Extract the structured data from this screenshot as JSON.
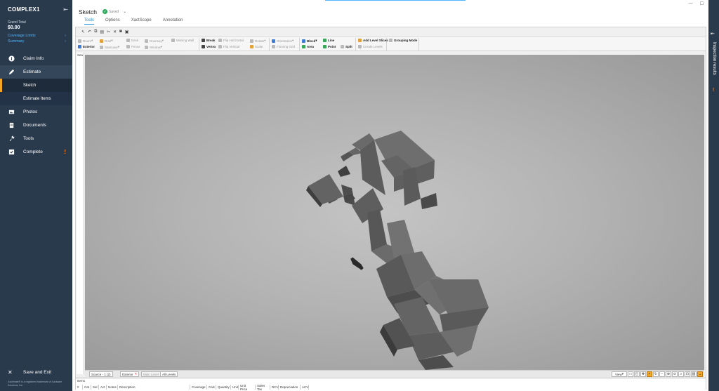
{
  "sidebar": {
    "title": "COMPLEX1",
    "grand_total_label": "Grand Total",
    "grand_total_value": "$0.00",
    "coverage_limits": "Coverage Limits",
    "summary": "Summary",
    "items": [
      {
        "label": "Claim Info",
        "icon": "info-icon"
      },
      {
        "label": "Estimate",
        "icon": "pencil-icon"
      },
      {
        "label": "Photos",
        "icon": "photos-icon"
      },
      {
        "label": "Documents",
        "icon": "documents-icon"
      },
      {
        "label": "Tools",
        "icon": "wrench-icon"
      },
      {
        "label": "Complete",
        "icon": "checklist-icon"
      }
    ],
    "sub_items": [
      {
        "label": "Sketch"
      },
      {
        "label": "Estimate Items"
      }
    ],
    "save_exit": "Save and Exit",
    "legal": "Xactimate® is a registered trademark of Xactware Solutions, Inc.",
    "accent_color": "#f5a623",
    "warn_color": "#f47b20"
  },
  "header": {
    "title": "Sketch",
    "saved": "Saved",
    "tabs": [
      "Tools",
      "Options",
      "XactScope",
      "Annotation"
    ]
  },
  "ribbon": {
    "col1": [
      "Room",
      "Exterior"
    ],
    "col2": [
      "Roof",
      "Staircase"
    ],
    "col3": [
      "Deck",
      "Fence"
    ],
    "col4": [
      "Doorway",
      "Window"
    ],
    "col5": [
      "Missing Wall"
    ],
    "col6": [
      "Break",
      "Vertex"
    ],
    "col7": [
      "Flip Horizontal",
      "Flip Vertical"
    ],
    "col8": [
      "Rotate",
      "Scale"
    ],
    "col9": [
      "Orientation",
      "Flooring Grid"
    ],
    "col10": [
      "Block",
      "Area"
    ],
    "col11": [
      "Line",
      "Point",
      "Split"
    ],
    "col12": [
      "Add Level Slices",
      "Create Levels"
    ],
    "col13": [
      "Grouping Mode"
    ]
  },
  "left_panel_label": "Sea",
  "bottom": {
    "source": "Source - 1 (2)",
    "exterior": "Exterior",
    "main_level": "Main Level",
    "all_levels": "All Levels",
    "view": "View"
  },
  "items_panel": {
    "title": "Items",
    "columns": [
      "#",
      "Cat",
      "Sel",
      "Act",
      "Notes",
      "Description",
      "Coverage",
      "Calc",
      "Quantity",
      "Unit",
      "Unit Price",
      "Sales Tax",
      "RCV",
      "Depreciation",
      "ACV"
    ]
  },
  "right_rail": {
    "label": "Inspection results"
  }
}
